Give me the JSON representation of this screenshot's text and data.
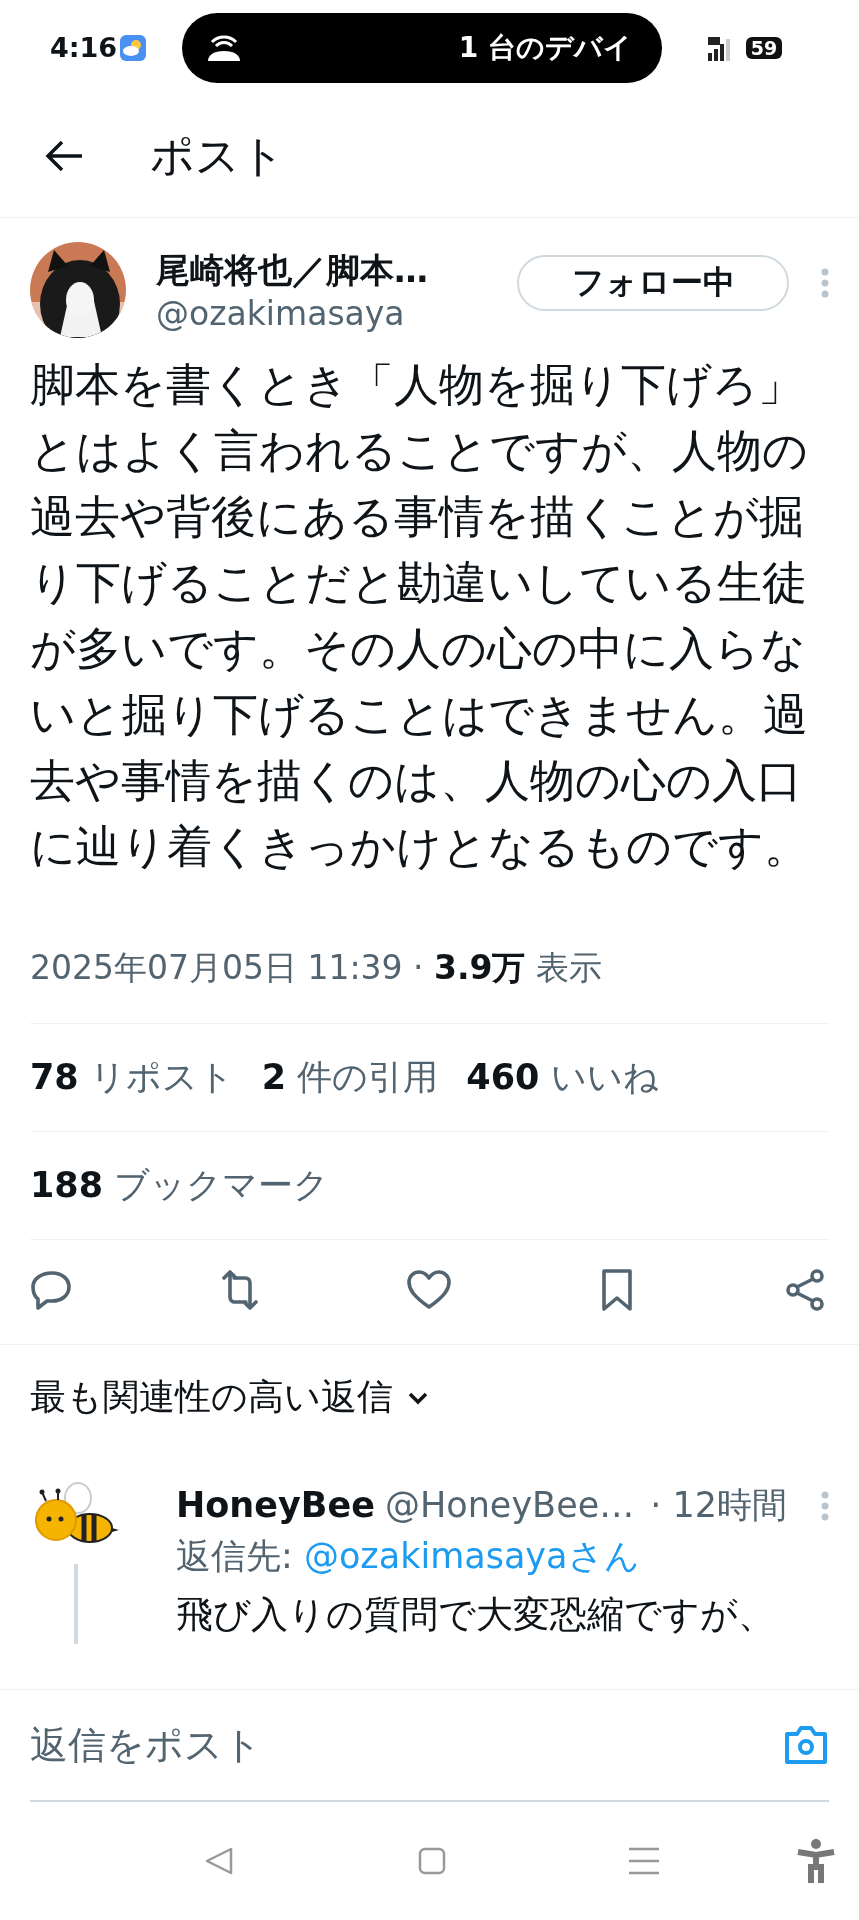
{
  "status_bar": {
    "time": "4:16",
    "notification": "1 台のデバイ",
    "battery": "59"
  },
  "header": {
    "title": "ポスト"
  },
  "post": {
    "author": "尾崎将也／脚本…",
    "handle": "@ozakimasaya",
    "follow_button": "フォロー中",
    "text": "脚本を書くとき「人物を掘り下げろ」とはよく言われることですが、人物の過去や背後にある事情を描くことが掘り下げることだと勘違いしている生徒が多いです。その人の心の中に入らないと掘り下げることはできません。過去や事情を描くのは、人物の心の入口に辿り着くきっかけとなるものです。",
    "meta": "2025年07月05日 11:39 · **3.9万** 表示"
  },
  "stats": [
    {
      "count": "78",
      "label": "リポスト"
    },
    {
      "count": "2",
      "label": "件の引用"
    },
    {
      "count": "460",
      "label": "いいね"
    }
  ],
  "bookmarks": {
    "count": "188",
    "label": "ブックマーク"
  },
  "replies_sort": {
    "label": "最も関連性の高い返信"
  },
  "replies": [
    {
      "name": "HoneyBee",
      "handle": "@HoneyBee…",
      "time": "· 12時間",
      "reply_to_label": "返信先:",
      "reply_to": "@ozakimasayaさん",
      "text": "飛び入りの質問で大変恐縮ですが、"
    }
  ],
  "composer": {
    "placeholder": "返信をポスト"
  }
}
